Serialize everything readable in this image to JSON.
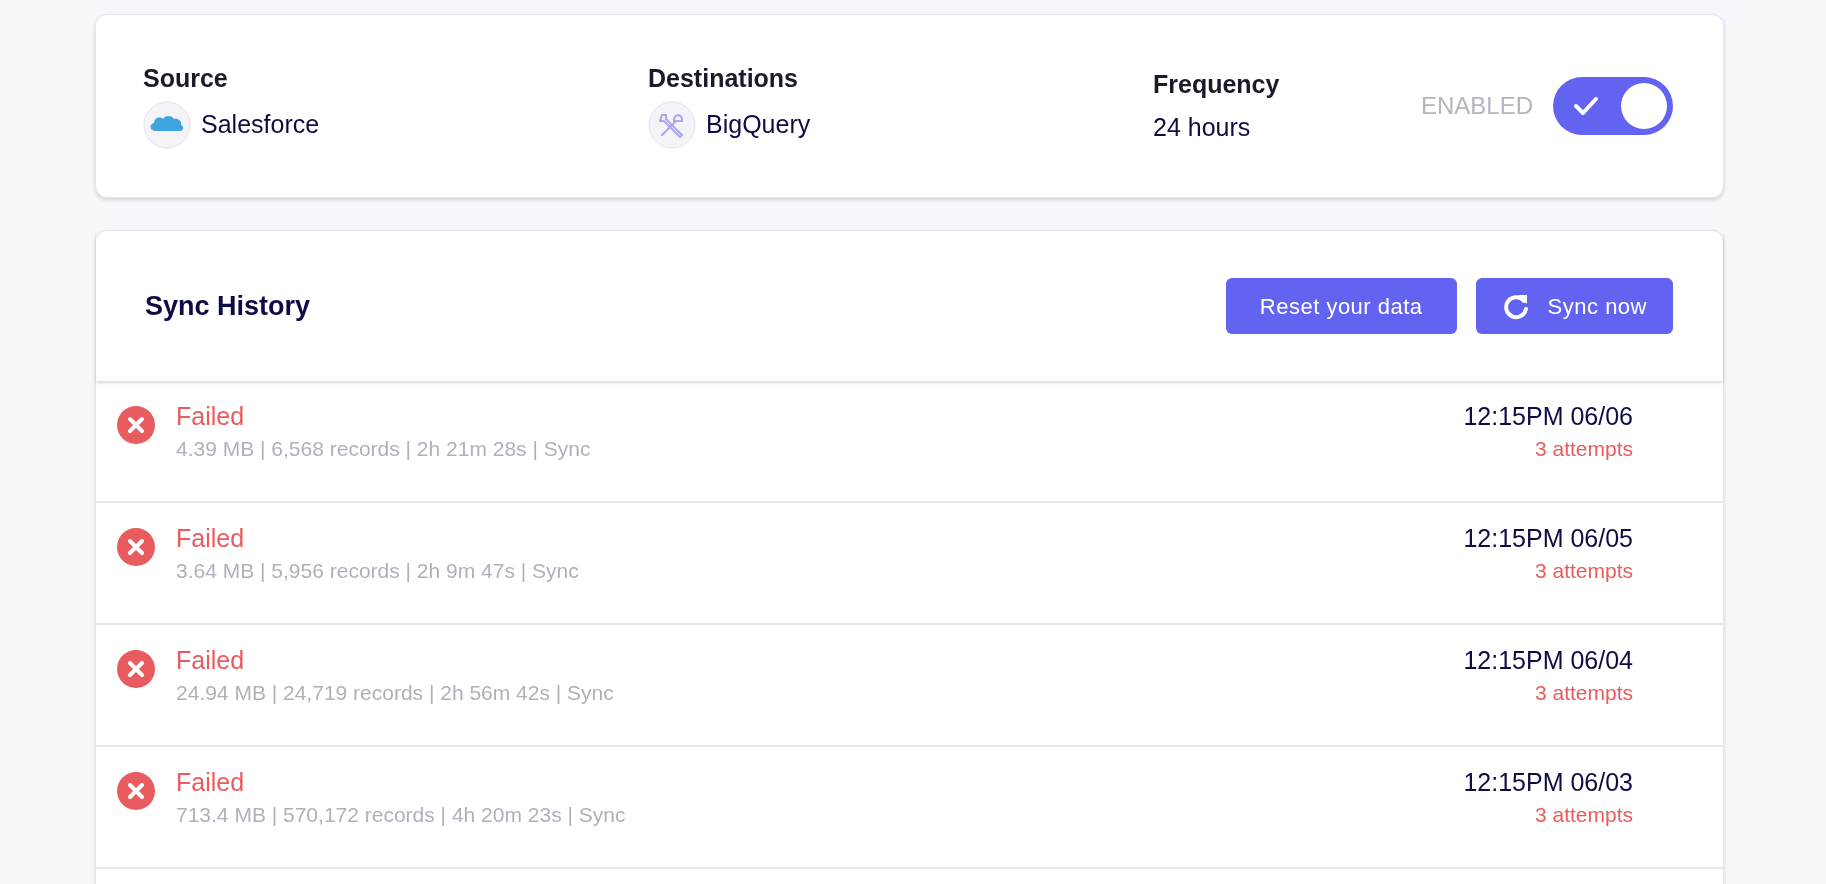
{
  "connection": {
    "source": {
      "label": "Source",
      "name": "Salesforce"
    },
    "destination": {
      "label": "Destinations",
      "name": "BigQuery"
    },
    "frequency": {
      "label": "Frequency",
      "value": "24 hours"
    },
    "toggle": {
      "label": "ENABLED",
      "on": true
    }
  },
  "sync_history": {
    "title": "Sync History",
    "buttons": [
      {
        "kind": "reset",
        "label": "Reset your data"
      },
      {
        "kind": "sync",
        "label": "Sync now"
      }
    ],
    "rows": [
      {
        "kind": "failed",
        "status": "Failed",
        "details": "4.39 MB | 6,568 records | 2h 21m 28s | Sync",
        "time": "12:15PM 06/06",
        "attempts": "3 attempts"
      },
      {
        "kind": "failed",
        "status": "Failed",
        "details": "3.64 MB | 5,956 records | 2h 9m 47s | Sync",
        "time": "12:15PM 06/05",
        "attempts": "3 attempts"
      },
      {
        "kind": "failed",
        "status": "Failed",
        "details": "24.94 MB | 24,719 records | 2h 56m 42s | Sync",
        "time": "12:15PM 06/04",
        "attempts": "3 attempts"
      },
      {
        "kind": "failed",
        "status": "Failed",
        "details": "713.4 MB | 570,172 records | 4h 20m 23s | Sync",
        "time": "12:15PM 06/03",
        "attempts": "3 attempts"
      }
    ]
  }
}
